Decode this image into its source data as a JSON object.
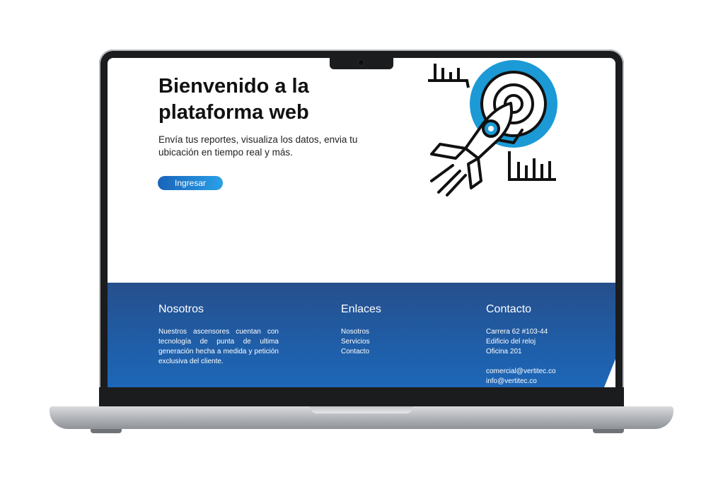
{
  "hero": {
    "title_line1": "Bienvenido a la",
    "title_line2": "plataforma web",
    "subtitle": "Envía tus reportes, visualiza los datos, envia tu ubicación en tiempo real y más.",
    "cta_label": "Ingresar",
    "illustration_icon": "rocket-target-icon"
  },
  "footer": {
    "about": {
      "heading": "Nosotros",
      "text": "Nuestros ascensores cuentan con tecnología de punta de ultima generación hecha a medida y petición exclusiva del cliente."
    },
    "links": {
      "heading": "Enlaces",
      "items": [
        "Nosotros",
        "Servicios",
        "Contacto"
      ]
    },
    "contact": {
      "heading": "Contacto",
      "address_line1": "Carrera 62 #103-44",
      "address_line2": "Edificio del reloj",
      "address_line3": "Oficina 201",
      "email1": "comercial@vertitec.co",
      "email2": "info@vertitec.co"
    }
  },
  "colors": {
    "accent": "#1c9ad6",
    "footer_bg": "#2359a0",
    "button_start": "#1864b8",
    "button_end": "#2aa0e8"
  }
}
